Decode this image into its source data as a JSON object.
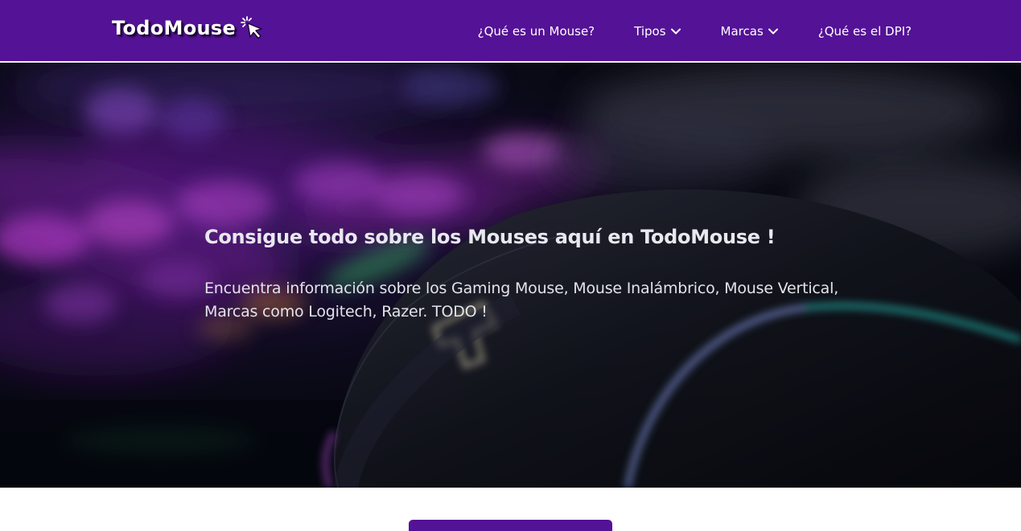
{
  "brand": {
    "name": "TodoMouse",
    "icon": "cursor-click-icon",
    "color": "#541296"
  },
  "nav": {
    "items": [
      {
        "label": "¿Qué es un Mouse?",
        "dropdown": false
      },
      {
        "label": "Tipos",
        "dropdown": true
      },
      {
        "label": "Marcas",
        "dropdown": true
      },
      {
        "label": "¿Qué es el DPI?",
        "dropdown": false
      }
    ]
  },
  "hero": {
    "title": "Consigue todo sobre los Mouses aquí en TodoMouse !",
    "subtitle": "Encuentra información sobre los Gaming Mouse, Mouse Inalámbrico, Mouse Vertical, Marcas como Logitech, Razer. TODO !"
  },
  "colors": {
    "navbar": "#541296",
    "hero_text": "#e8e8ef",
    "button": "#541296"
  }
}
